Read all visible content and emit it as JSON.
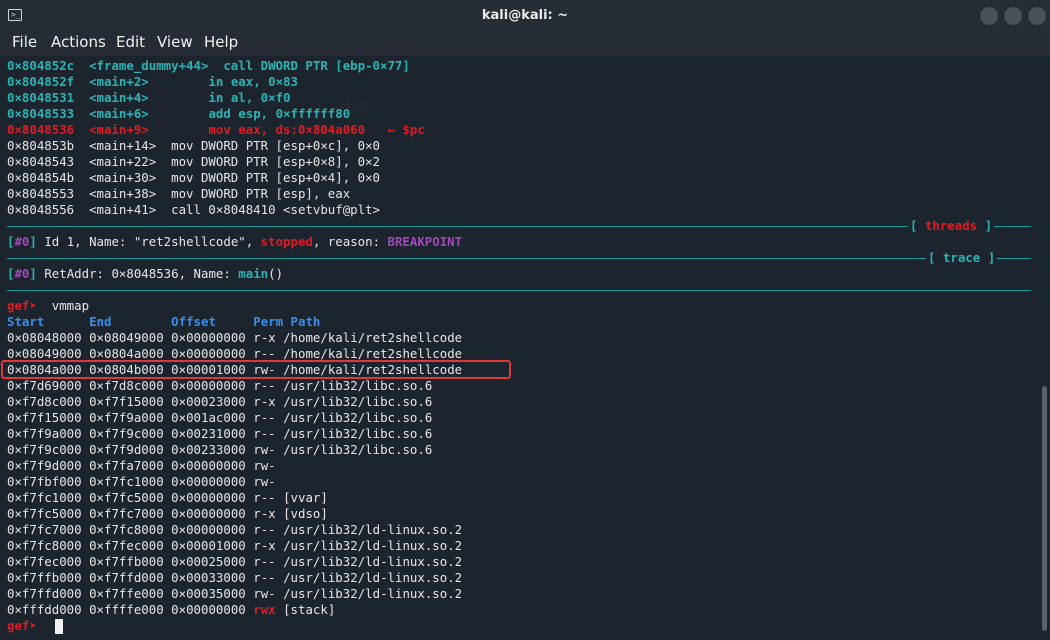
{
  "window": {
    "title": "kali@kali: ~",
    "terminal_icon_glyph": ">_"
  },
  "menu": {
    "file": "File",
    "actions": "Actions",
    "edit": "Edit",
    "view": "View",
    "help": "Help"
  },
  "disasm": [
    {
      "addr": "0×804852c",
      "sym": "<frame_dummy+44>",
      "ins": "call DWORD PTR [ebp-0×77]"
    },
    {
      "addr": "0×804852f",
      "sym": "<main+2>",
      "ins": "in eax, 0×83"
    },
    {
      "addr": "0×8048531",
      "sym": "<main+4>",
      "ins": "in al, 0×f0"
    },
    {
      "addr": "0×8048533",
      "sym": "<main+6>",
      "ins": "add esp, 0×ffffff80"
    }
  ],
  "current": {
    "addr": "0×8048536",
    "sym": "<main+9>",
    "ins": "mov eax, ds:0×804a060",
    "marker": "← $pc"
  },
  "upcoming": [
    {
      "addr": "0×804853b",
      "sym": "<main+14>",
      "ins": "mov DWORD PTR [esp+0×c], 0×0"
    },
    {
      "addr": "0×8048543",
      "sym": "<main+22>",
      "ins": "mov DWORD PTR [esp+0×8], 0×2"
    },
    {
      "addr": "0×804854b",
      "sym": "<main+30>",
      "ins": "mov DWORD PTR [esp+0×4], 0×0"
    },
    {
      "addr": "0×8048553",
      "sym": "<main+38>",
      "ins": "mov DWORD PTR [esp], eax"
    },
    {
      "addr": "0×8048556",
      "sym": "<main+41>",
      "ins": "call 0×8048410 <setvbuf@plt>"
    }
  ],
  "sections": {
    "threads": "threads",
    "trace": "trace"
  },
  "thread": {
    "index": "#0",
    "text_a": "Id 1, Name: \"ret2shellcode\", ",
    "state": "stopped",
    "text_b": ", reason: ",
    "reason": "BREAKPOINT"
  },
  "trace": {
    "index": "#0",
    "text_a": "RetAddr: 0×8048536, Name: ",
    "name": "main",
    "text_b": "()"
  },
  "prompt": {
    "label": "gef➤",
    "command": "vmmap"
  },
  "vmmap": {
    "headers": {
      "start": "Start",
      "end": "End",
      "offset": "Offset",
      "perm": "Perm",
      "path": "Path"
    },
    "rows": [
      {
        "start": "0×08048000",
        "end": "0×08049000",
        "offset": "0×00000000",
        "perm": "r-x",
        "path": "/home/kali/ret2shellcode"
      },
      {
        "start": "0×08049000",
        "end": "0×0804a000",
        "offset": "0×00000000",
        "perm": "r--",
        "path": "/home/kali/ret2shellcode"
      },
      {
        "start": "0×0804a000",
        "end": "0×0804b000",
        "offset": "0×00001000",
        "perm": "rw-",
        "path": "/home/kali/ret2shellcode"
      },
      {
        "start": "0×f7d69000",
        "end": "0×f7d8c000",
        "offset": "0×00000000",
        "perm": "r--",
        "path": "/usr/lib32/libc.so.6"
      },
      {
        "start": "0×f7d8c000",
        "end": "0×f7f15000",
        "offset": "0×00023000",
        "perm": "r-x",
        "path": "/usr/lib32/libc.so.6"
      },
      {
        "start": "0×f7f15000",
        "end": "0×f7f9a000",
        "offset": "0×001ac000",
        "perm": "r--",
        "path": "/usr/lib32/libc.so.6"
      },
      {
        "start": "0×f7f9a000",
        "end": "0×f7f9c000",
        "offset": "0×00231000",
        "perm": "r--",
        "path": "/usr/lib32/libc.so.6"
      },
      {
        "start": "0×f7f9c000",
        "end": "0×f7f9d000",
        "offset": "0×00233000",
        "perm": "rw-",
        "path": "/usr/lib32/libc.so.6"
      },
      {
        "start": "0×f7f9d000",
        "end": "0×f7fa7000",
        "offset": "0×00000000",
        "perm": "rw-",
        "path": ""
      },
      {
        "start": "0×f7fbf000",
        "end": "0×f7fc1000",
        "offset": "0×00000000",
        "perm": "rw-",
        "path": ""
      },
      {
        "start": "0×f7fc1000",
        "end": "0×f7fc5000",
        "offset": "0×00000000",
        "perm": "r--",
        "path": "[vvar]"
      },
      {
        "start": "0×f7fc5000",
        "end": "0×f7fc7000",
        "offset": "0×00000000",
        "perm": "r-x",
        "path": "[vdso]"
      },
      {
        "start": "0×f7fc7000",
        "end": "0×f7fc8000",
        "offset": "0×00000000",
        "perm": "r--",
        "path": "/usr/lib32/ld-linux.so.2"
      },
      {
        "start": "0×f7fc8000",
        "end": "0×f7fec000",
        "offset": "0×00001000",
        "perm": "r-x",
        "path": "/usr/lib32/ld-linux.so.2"
      },
      {
        "start": "0×f7fec000",
        "end": "0×f7ffb000",
        "offset": "0×00025000",
        "perm": "r--",
        "path": "/usr/lib32/ld-linux.so.2"
      },
      {
        "start": "0×f7ffb000",
        "end": "0×f7ffd000",
        "offset": "0×00033000",
        "perm": "r--",
        "path": "/usr/lib32/ld-linux.so.2"
      },
      {
        "start": "0×f7ffd000",
        "end": "0×f7ffe000",
        "offset": "0×00035000",
        "perm": "rw-",
        "path": "/usr/lib32/ld-linux.so.2"
      },
      {
        "start": "0×fffdd000",
        "end": "0×ffffe000",
        "offset": "0×00000000",
        "perm": "rwx",
        "path": "[stack]"
      }
    ]
  },
  "final_prompt": "gef➤",
  "colors": {
    "background": "#1c242e",
    "cyan": "#22a6a6",
    "red": "#e01b24",
    "purple": "#a347ba",
    "blue": "#3b8eea",
    "highlight_box": "#e03838"
  }
}
